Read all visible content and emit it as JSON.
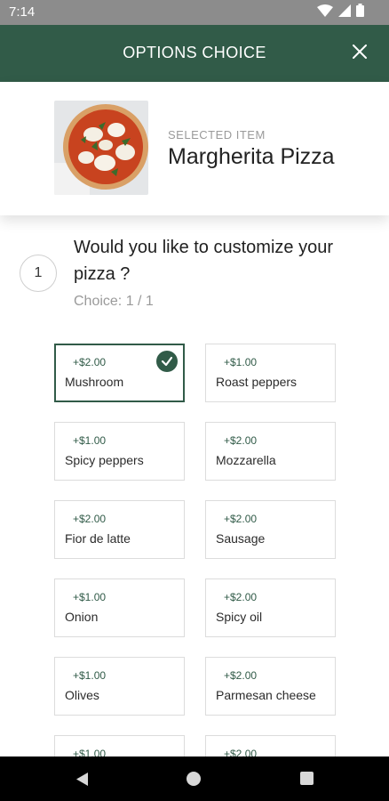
{
  "status_bar": {
    "time": "7:14",
    "icons": [
      "wifi-icon",
      "signal-icon",
      "battery-icon"
    ]
  },
  "header": {
    "title": "OPTIONS CHOICE",
    "close_icon": "close-icon",
    "background_color": "#315b48"
  },
  "item": {
    "kicker": "SELECTED ITEM",
    "name": "Margherita Pizza"
  },
  "question": {
    "step": "1",
    "text": "Would you like to customize your pizza ?",
    "choice_count": "Choice: 1 / 1"
  },
  "options": [
    {
      "price": "+$2.00",
      "name": "Mushroom",
      "selected": true
    },
    {
      "price": "+$1.00",
      "name": "Roast peppers",
      "selected": false
    },
    {
      "price": "+$1.00",
      "name": "Spicy peppers",
      "selected": false
    },
    {
      "price": "+$2.00",
      "name": "Mozzarella",
      "selected": false
    },
    {
      "price": "+$2.00",
      "name": "Fior de latte",
      "selected": false
    },
    {
      "price": "+$2.00",
      "name": "Sausage",
      "selected": false
    },
    {
      "price": "+$1.00",
      "name": "Onion",
      "selected": false
    },
    {
      "price": "+$2.00",
      "name": "Spicy oil",
      "selected": false
    },
    {
      "price": "+$1.00",
      "name": "Olives",
      "selected": false
    },
    {
      "price": "+$2.00",
      "name": "Parmesan cheese",
      "selected": false
    },
    {
      "price": "+$1.00",
      "name": "",
      "selected": false
    },
    {
      "price": "+$2.00",
      "name": "",
      "selected": false
    }
  ],
  "accent_color": "#315b48"
}
